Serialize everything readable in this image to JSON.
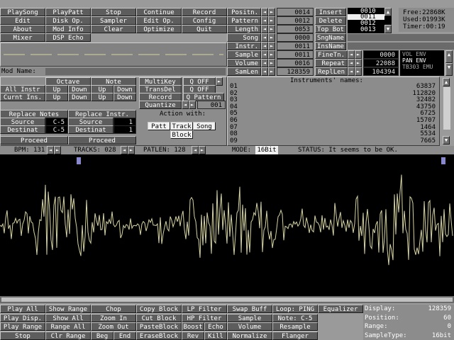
{
  "transport": {
    "row1": [
      "PlaySong",
      "PlayPatt",
      "Stop",
      "Continue",
      "Record"
    ],
    "row2": [
      "Edit",
      "Disk Op.",
      "Sampler",
      "Edit Op.",
      "Config"
    ],
    "row3": [
      "About",
      "Mod Info",
      "Clear",
      "Optimize",
      "Quit"
    ],
    "row4": [
      "Mixer",
      "DSP Echo"
    ]
  },
  "song_params": [
    {
      "label": "Positn.",
      "value": "0014"
    },
    {
      "label": "Pattern",
      "value": "0012"
    },
    {
      "label": "Length",
      "value": "0053"
    },
    {
      "label": "Song",
      "value": "0000"
    },
    {
      "label": "Instr.",
      "value": "0011"
    },
    {
      "label": "Sample",
      "value": "0011"
    },
    {
      "label": "Volume",
      "value": "0016"
    },
    {
      "label": "SamLen",
      "value": "128359"
    }
  ],
  "right_buttons": [
    "Insert",
    "Delete",
    "Top Bot",
    "SngName",
    "InsName",
    "FineTn.",
    "Repeat",
    "ReplLen"
  ],
  "order_list": [
    "0010",
    "0011",
    "0012",
    "0013"
  ],
  "fine": {
    "finetune": "0000",
    "repeat": "22088",
    "repllen": "104394"
  },
  "mem": {
    "free": "Free:22868K",
    "used": "Used:01993K",
    "timer": "Timer:00:19"
  },
  "env": [
    "VOL ENV",
    "PAN ENV",
    "TB303 EMU"
  ],
  "mod_name_label": "Mod Name:",
  "edit_panel": {
    "octave": "Octave",
    "note": "Note",
    "multikey": "MultiKey",
    "off1": "Q OFF",
    "transdel": "TransDel",
    "off2": "Q OFF",
    "all_instr": "All Instr",
    "curnt_ins": "Curnt Ins.",
    "up": "Up",
    "down": "Down",
    "record": "Record",
    "pattern": "Q Pattern",
    "quantize": "Quantize",
    "q_val": "001",
    "replace_notes": "Replace Notes",
    "replace_instr": "Replace Instr.",
    "action_with": "Action with:",
    "source": "Source",
    "destinat": "Destinat",
    "c5": "C-5",
    "one": "1",
    "patt": "Patt",
    "track": "Track",
    "song": "Song",
    "block": "Block",
    "proceed": "Proceed"
  },
  "instruments": {
    "title": "Instruments' names:",
    "rows": [
      {
        "no": "01",
        "size": "63837"
      },
      {
        "no": "02",
        "size": "112820"
      },
      {
        "no": "03",
        "size": "32482"
      },
      {
        "no": "04",
        "size": "43750"
      },
      {
        "no": "05",
        "size": "6725"
      },
      {
        "no": "06",
        "size": "15707"
      },
      {
        "no": "07",
        "size": "1464"
      },
      {
        "no": "08",
        "size": "5534"
      },
      {
        "no": "09",
        "size": "7665"
      }
    ]
  },
  "status_bar": {
    "bpm": "BPM: 131",
    "tracks": "TRACKS: 028",
    "patlen": "PATLEN: 128",
    "mode_label": "MODE:",
    "mode": "16Bit",
    "status": "STATUS: It seems to be OK."
  },
  "sample_tools": {
    "row1": [
      "Play All",
      "Show Range",
      "Chop",
      "Copy Block",
      "LP Filter",
      "Swap Buff",
      "Loop: PING",
      "Equalizer"
    ],
    "row2": [
      "Play Disp.",
      "Show All",
      "Zoom In",
      "Cut Block",
      "HP Filter",
      "Sample",
      "Note: C-5"
    ],
    "row3": [
      "Play Range",
      "Range All",
      "Zoom Out",
      "PasteBlock",
      "Boost",
      "Echo",
      "Volume",
      "Resample"
    ],
    "row4": [
      "Stop",
      "Clr Range",
      "Beg",
      "End",
      "EraseBlock",
      "Rev",
      "Kill",
      "Normalize",
      "Flanger"
    ]
  },
  "sample_info": [
    {
      "label": "Display:",
      "value": "128359"
    },
    {
      "label": "Position:",
      "value": "60"
    },
    {
      "label": "Range:",
      "value": "0"
    },
    {
      "label": "SampleType:",
      "value": "16bit"
    }
  ],
  "colors": {
    "button": "#5d5d5d",
    "panel": "#8c8c8c",
    "wave": "#d6d4a0",
    "marker": "#8888cc"
  }
}
